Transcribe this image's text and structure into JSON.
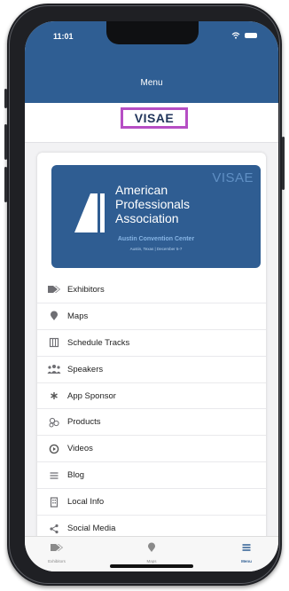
{
  "status_bar": {
    "time": "11:01",
    "icons": [
      "wifi-icon",
      "battery-icon"
    ]
  },
  "header": {
    "title": "Menu"
  },
  "logo": {
    "text": "VISAE"
  },
  "banner": {
    "brand": "VISAE",
    "org_line1": "American",
    "org_line2": "Professionals",
    "org_line3": "Association",
    "venue": "Austin Convention Center",
    "location_dates": "Austin, Texas | December 5-7"
  },
  "menu": [
    {
      "label": "Exhibitors",
      "icon": "tag-icon"
    },
    {
      "label": "Maps",
      "icon": "map-pin-icon"
    },
    {
      "label": "Schedule Tracks",
      "icon": "calendar-icon"
    },
    {
      "label": "Speakers",
      "icon": "people-icon"
    },
    {
      "label": "App Sponsor",
      "icon": "asterisk-icon"
    },
    {
      "label": "Products",
      "icon": "products-icon"
    },
    {
      "label": "Videos",
      "icon": "play-icon"
    },
    {
      "label": "Blog",
      "icon": "lines-icon"
    },
    {
      "label": "Local Info",
      "icon": "building-icon"
    },
    {
      "label": "Social Media",
      "icon": "share-icon"
    }
  ],
  "tabbar": [
    {
      "label": "Exhibitors",
      "icon": "tag-icon",
      "active": false
    },
    {
      "label": "Maps",
      "icon": "map-pin-icon",
      "active": false
    },
    {
      "label": "Menu",
      "icon": "menu-icon",
      "active": true
    }
  ],
  "colors": {
    "primary": "#2f5e93",
    "logo_border": "#b64ec4",
    "icon_gray": "#6e6e73"
  }
}
